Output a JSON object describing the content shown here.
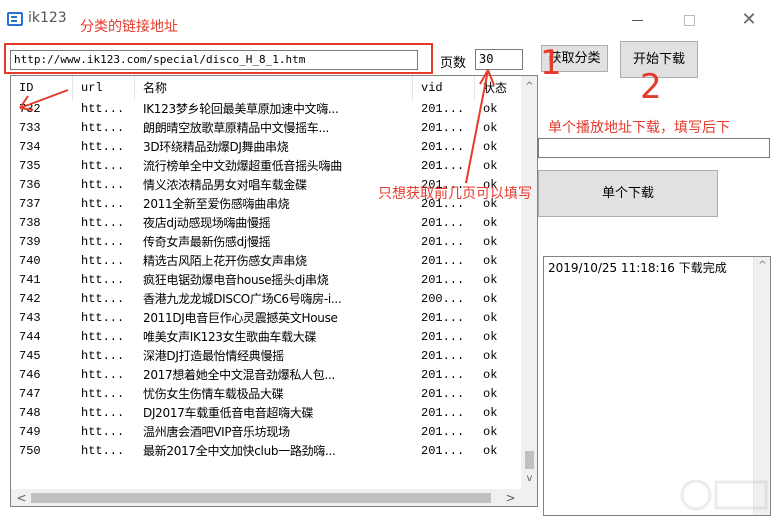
{
  "window": {
    "title": "ik123",
    "min_label": "—",
    "max_label": "□",
    "close_label": "✕"
  },
  "annotations": {
    "url_note": "分类的链接地址",
    "single_note": "单个播放地址下载，填写后下",
    "pages_note": "只想获取前几页可以填写",
    "mark_1": "1",
    "mark_2": "2"
  },
  "url_field": {
    "value": "http://www.ik123.com/special/disco_H_8_1.htm"
  },
  "pages": {
    "label": "页数",
    "value": "30"
  },
  "buttons": {
    "fetch_label": "获取分类",
    "start_label": "开始下载",
    "single_label": "单个下载"
  },
  "single_input": {
    "value": ""
  },
  "log": {
    "text": "2019/10/25 11:18:16 下载完成"
  },
  "list": {
    "columns": [
      "ID",
      "url",
      "名称",
      "vid",
      "状态"
    ],
    "rows": [
      {
        "id": "732",
        "url": "htt...",
        "name": "IK123梦乡轮回最美草原加速中文嗨...",
        "vid": "201...",
        "status": "ok"
      },
      {
        "id": "733",
        "url": "htt...",
        "name": "朗朗晴空放歌草原精品中文慢摇车...",
        "vid": "201...",
        "status": "ok"
      },
      {
        "id": "734",
        "url": "htt...",
        "name": "3D环绕精品劲爆DJ舞曲串烧",
        "vid": "201...",
        "status": "ok"
      },
      {
        "id": "735",
        "url": "htt...",
        "name": "流行榜单全中文劲爆超重低音摇头嗨曲",
        "vid": "201...",
        "status": "ok"
      },
      {
        "id": "736",
        "url": "htt...",
        "name": "情义浓浓精品男女对唱车载金碟",
        "vid": "201...",
        "status": "ok"
      },
      {
        "id": "737",
        "url": "htt...",
        "name": "2011全新至爱伤感嗨曲串烧",
        "vid": "201...",
        "status": "ok"
      },
      {
        "id": "738",
        "url": "htt...",
        "name": "夜店dj动感现场嗨曲慢摇",
        "vid": "201...",
        "status": "ok"
      },
      {
        "id": "739",
        "url": "htt...",
        "name": "传奇女声最新伤感dj慢摇",
        "vid": "201...",
        "status": "ok"
      },
      {
        "id": "740",
        "url": "htt...",
        "name": "精选古风陌上花开伤感女声串烧",
        "vid": "201...",
        "status": "ok"
      },
      {
        "id": "741",
        "url": "htt...",
        "name": "疯狂电锯劲爆电音house摇头dj串烧",
        "vid": "201...",
        "status": "ok"
      },
      {
        "id": "742",
        "url": "htt...",
        "name": "香港九龙龙城DISCO广场C6号嗨房-i...",
        "vid": "200...",
        "status": "ok"
      },
      {
        "id": "743",
        "url": "htt...",
        "name": "2011DJ电音巨作心灵震撼英文House",
        "vid": "201...",
        "status": "ok"
      },
      {
        "id": "744",
        "url": "htt...",
        "name": "唯美女声IK123女生歌曲车载大碟",
        "vid": "201...",
        "status": "ok"
      },
      {
        "id": "745",
        "url": "htt...",
        "name": "深港DJ打造最怡情经典慢摇",
        "vid": "201...",
        "status": "ok"
      },
      {
        "id": "746",
        "url": "htt...",
        "name": "2017想着她全中文混音劲爆私人包...",
        "vid": "201...",
        "status": "ok"
      },
      {
        "id": "747",
        "url": "htt...",
        "name": "忧伤女生伤情车载极品大碟",
        "vid": "201...",
        "status": "ok"
      },
      {
        "id": "748",
        "url": "htt...",
        "name": "DJ2017车载重低音电音超嗨大碟",
        "vid": "201...",
        "status": "ok"
      },
      {
        "id": "749",
        "url": "htt...",
        "name": "温州唐会酒吧VIP音乐坊现场",
        "vid": "201...",
        "status": "ok"
      },
      {
        "id": "750",
        "url": "htt...",
        "name": "最新2017全中文加快club一路劲嗨...",
        "vid": "201...",
        "status": "ok"
      }
    ]
  },
  "scroll": {
    "up": "^",
    "down": "v",
    "left": "<",
    "right": ">"
  },
  "colors": {
    "annotation_red": "#e53b2c",
    "button_bg": "#e1e1e1",
    "icon_blue": "#2b6fd8"
  },
  "icons": {
    "app": "app-icon",
    "minimize": "minimize-icon",
    "maximize": "maximize-icon",
    "close": "close-icon"
  }
}
